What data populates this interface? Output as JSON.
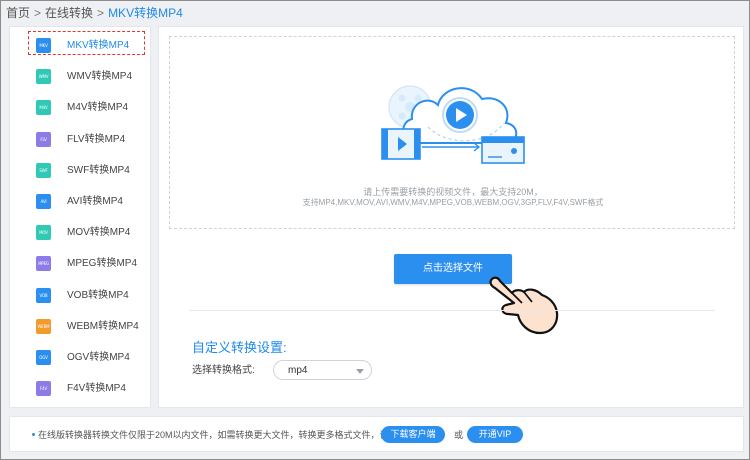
{
  "breadcrumb": {
    "home": "首页",
    "online": "在线转换",
    "current": "MKV转换MP4",
    "separator": ">"
  },
  "sidebar": {
    "active_index": 0,
    "items": [
      {
        "icon_text": "MKV",
        "label": "MKV转换MP4",
        "color": "#2b8ff0"
      },
      {
        "icon_text": "WMV",
        "label": "WMV转换MP4",
        "color": "#2fc9b5"
      },
      {
        "icon_text": "M4V",
        "label": "M4V转换MP4",
        "color": "#2fc9b5"
      },
      {
        "icon_text": "FLV",
        "label": "FLV转换MP4",
        "color": "#8d7be8"
      },
      {
        "icon_text": "SWF",
        "label": "SWF转换MP4",
        "color": "#2fc9b5"
      },
      {
        "icon_text": "AVI",
        "label": "AVI转换MP4",
        "color": "#2b8ff0"
      },
      {
        "icon_text": "MOV",
        "label": "MOV转换MP4",
        "color": "#2fc9b5"
      },
      {
        "icon_text": "MPEG",
        "label": "MPEG转换MP4",
        "color": "#8d7be8"
      },
      {
        "icon_text": "VOB",
        "label": "VOB转换MP4",
        "color": "#2b8ff0"
      },
      {
        "icon_text": "WEBM",
        "label": "WEBM转换MP4",
        "color": "#f39a2b"
      },
      {
        "icon_text": "OGV",
        "label": "OGV转换MP4",
        "color": "#2b8ff0"
      },
      {
        "icon_text": "F4V",
        "label": "F4V转换MP4",
        "color": "#8d7be8"
      }
    ]
  },
  "upload": {
    "hint_line1": "请上传需要转换的视频文件，最大支持20M，",
    "hint_line2": "支持MP4,MKV,MOV,AVI,WMV,M4V,MPEG,VOB,WEBM,OGV,3GP,FLV,F4V,SWF格式",
    "choose_button": "点击选择文件",
    "illustration_icon": "cloud-video-upload-icon",
    "cursor_icon": "pointing-hand-icon"
  },
  "settings": {
    "title": "自定义转换设置:",
    "format_label": "选择转换格式:",
    "format_value": "mp4"
  },
  "notice": {
    "message": "在线版转换器转换文件仅限于20M以内文件，如需转换更大文件，转换更多格式文件，请",
    "download_button": "下载客户端",
    "or_text": "或",
    "vip_button": "开通VIP"
  },
  "colors": {
    "accent": "#2b8ff0",
    "link": "#1f8ae8",
    "active_outline": "#e0342c",
    "background": "#eef0f3"
  }
}
